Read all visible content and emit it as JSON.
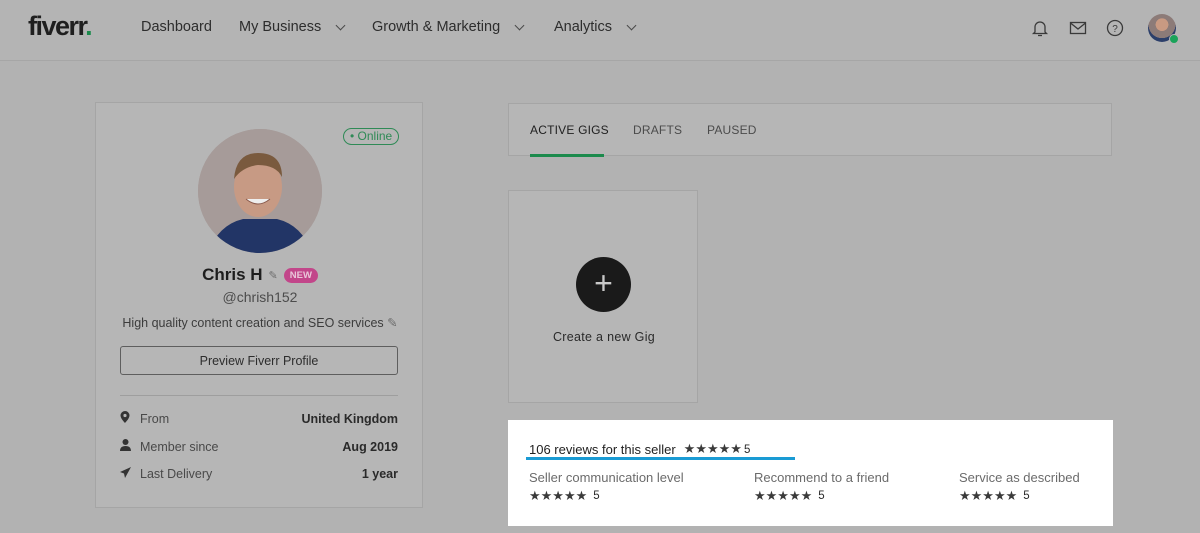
{
  "header": {
    "logo_text": "fiverr",
    "logo_dot": ".",
    "nav": [
      {
        "label": "Dashboard",
        "has_dropdown": false
      },
      {
        "label": "My Business",
        "has_dropdown": true
      },
      {
        "label": "Growth & Marketing",
        "has_dropdown": true
      },
      {
        "label": "Analytics",
        "has_dropdown": true
      }
    ],
    "icons": [
      "bell-icon",
      "mail-icon",
      "help-icon"
    ],
    "user_status": "online"
  },
  "profile": {
    "online_badge": "• Online",
    "name": "Chris H",
    "new_badge": "NEW",
    "username": "@chrish152",
    "tagline": "High quality content creation and SEO services",
    "preview_button": "Preview Fiverr Profile",
    "info": [
      {
        "icon": "location-icon",
        "label": "From",
        "value": "United Kingdom"
      },
      {
        "icon": "user-icon",
        "label": "Member since",
        "value": "Aug 2019"
      },
      {
        "icon": "send-icon",
        "label": "Last Delivery",
        "value": "1 year"
      }
    ]
  },
  "gigs": {
    "tabs": [
      {
        "label": "ACTIVE GIGS",
        "active": true
      },
      {
        "label": "DRAFTS",
        "active": false
      },
      {
        "label": "PAUSED",
        "active": false
      }
    ],
    "create_label": "Create a new Gig"
  },
  "reviews": {
    "title": "106 reviews for this seller",
    "stars": "★★★★★",
    "overall_rating": "5",
    "criteria": [
      {
        "label": "Seller communication level",
        "stars": "★★★★★",
        "rating": "5"
      },
      {
        "label": "Recommend to a friend",
        "stars": "★★★★★",
        "rating": "5"
      },
      {
        "label": "Service as described",
        "stars": "★★★★★",
        "rating": "5"
      }
    ]
  },
  "colors": {
    "brand_green": "#1b8a4c",
    "new_badge": "#c2468a",
    "review_underline": "#1a9bd4"
  }
}
